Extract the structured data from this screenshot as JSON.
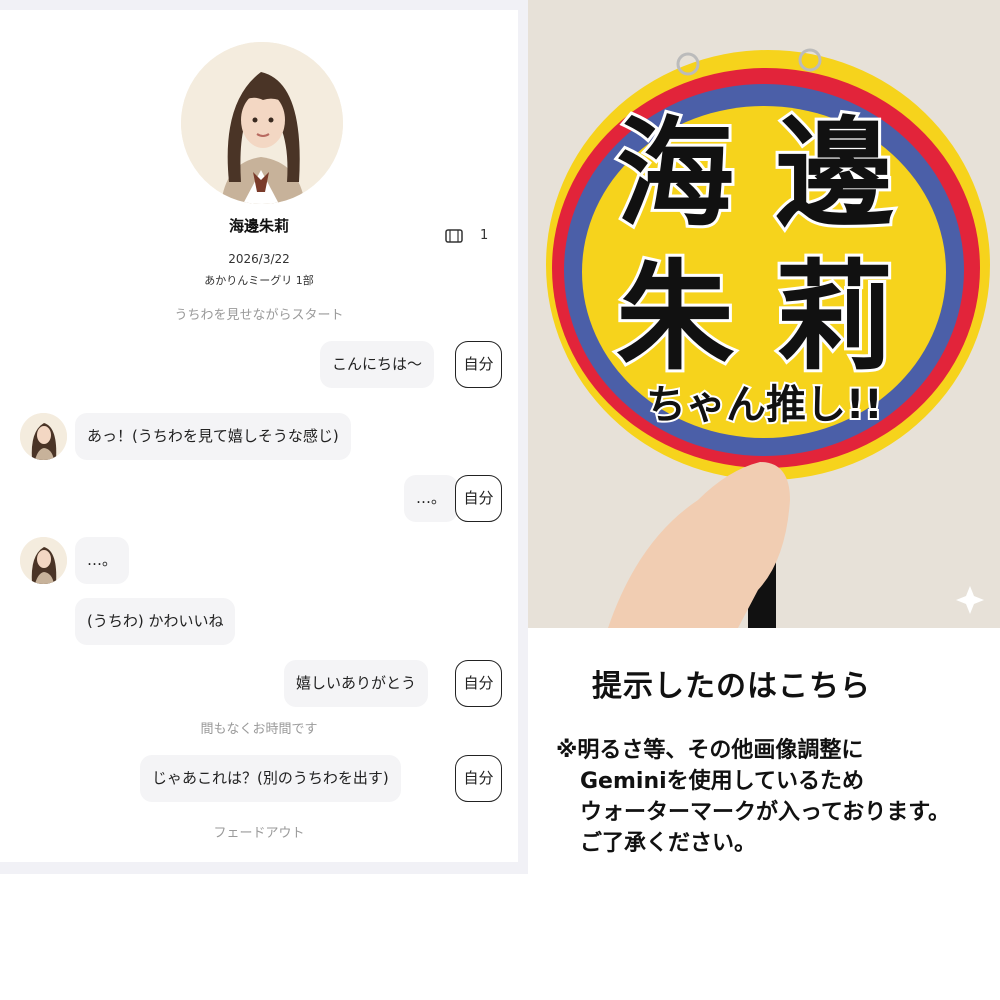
{
  "chat": {
    "profile": {
      "name": "海邊朱莉",
      "count": "1",
      "date": "2026/3/22",
      "subtitle": "あかりんミーグリ 1部"
    },
    "system": {
      "start": "うちわを見せながらスタート",
      "time_notice": "間もなくお時間です",
      "fade": "フェードアウト"
    },
    "self_label": "自分",
    "messages": [
      {
        "from": "self",
        "text": "こんにちは〜"
      },
      {
        "from": "other",
        "text": "あっ！(うちわを見て嬉しそうな感じ)"
      },
      {
        "from": "self",
        "text": "…。"
      },
      {
        "from": "other",
        "text": "…。"
      },
      {
        "from": "other",
        "text": "(うちわ) かわいいね"
      },
      {
        "from": "self",
        "text": "嬉しいありがとう"
      },
      {
        "from": "self",
        "text": "じゃあこれは？(別のうちわを出す)"
      }
    ]
  },
  "photo": {
    "fan_line1": "海 邊",
    "fan_line2": "朱 莉",
    "fan_line3": "ちゃん推し!!"
  },
  "caption": {
    "title": "提示したのはこちら",
    "note_line1": "※明るさ等、その他画像調整に",
    "note_line2": "Geminiを使用しているため",
    "note_line3": "ウォーターマークが入っております。",
    "note_line4": "ご了承ください。"
  },
  "colors": {
    "fan_yellow": "#f6d31c",
    "fan_red": "#e2243a",
    "fan_blue": "#4b5fa8",
    "wall": "#e7e1d8"
  },
  "icons": [
    "book-icon",
    "sparkle-icon"
  ]
}
